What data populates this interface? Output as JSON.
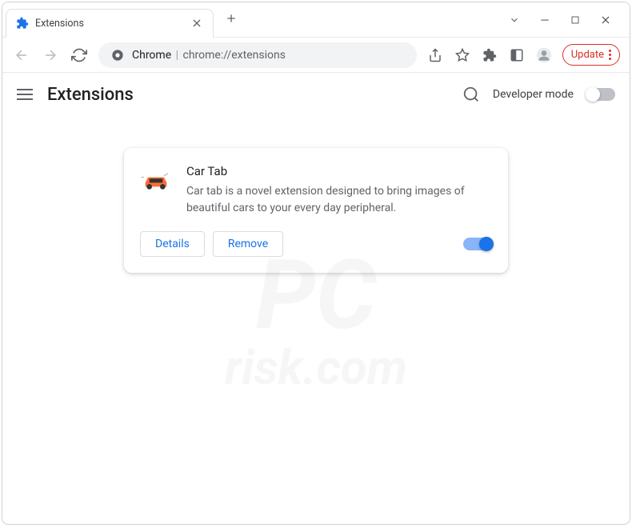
{
  "tab": {
    "title": "Extensions"
  },
  "omnibox": {
    "prefix": "Chrome",
    "url": "chrome://extensions"
  },
  "toolbar": {
    "update_label": "Update"
  },
  "page": {
    "title": "Extensions",
    "dev_mode_label": "Developer mode"
  },
  "extension": {
    "name": "Car Tab",
    "description": "Car tab is a novel extension designed to bring images of beautiful cars to your every day peripheral.",
    "details_label": "Details",
    "remove_label": "Remove",
    "enabled": true
  },
  "watermark": {
    "main": "PC",
    "sub": "risk.com"
  }
}
